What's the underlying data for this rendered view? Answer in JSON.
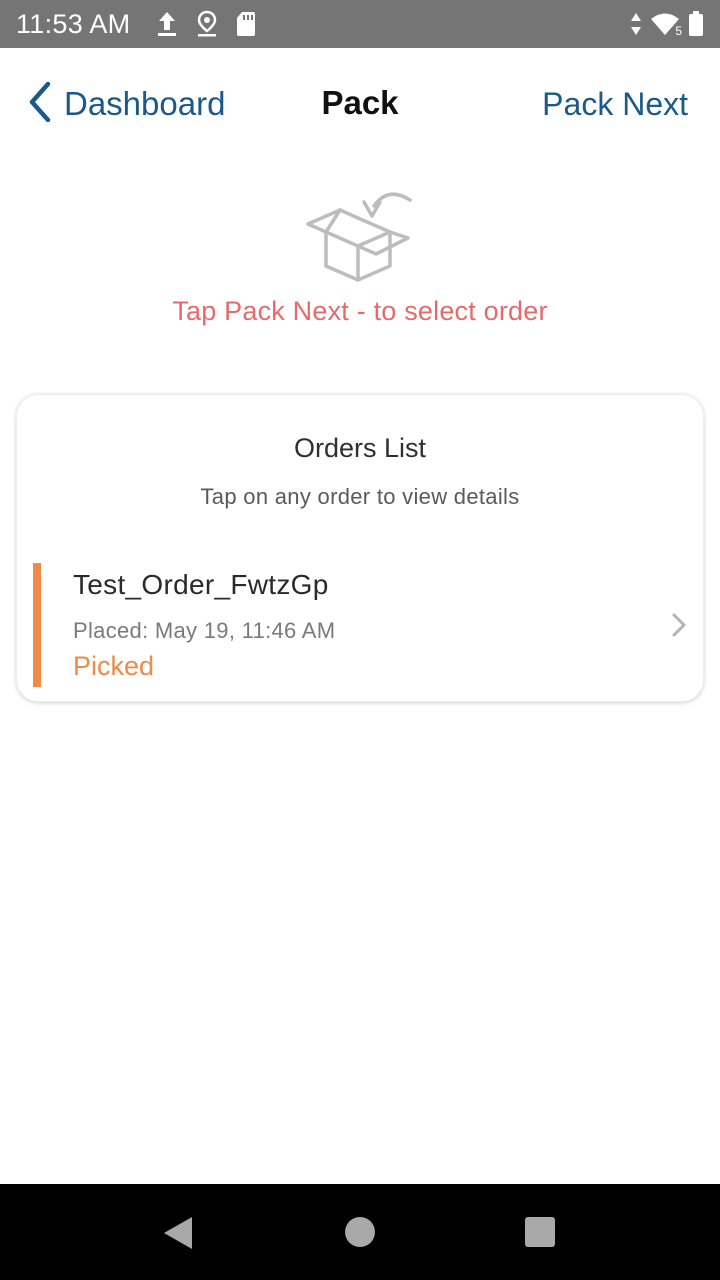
{
  "status_bar": {
    "time": "11:53 AM",
    "left_icons": [
      "upload-icon",
      "location-icon",
      "sd-card-icon"
    ],
    "right_icons": [
      "data-arrows-icon",
      "wifi-icon",
      "battery-icon"
    ],
    "wifi_badge": "5"
  },
  "header": {
    "back_label": "Dashboard",
    "title": "Pack",
    "action_label": "Pack Next"
  },
  "prompt": {
    "icon": "box-return-icon",
    "text": "Tap Pack Next - to select order"
  },
  "orders_card": {
    "title": "Orders List",
    "subtitle": "Tap on any order to view details",
    "orders": [
      {
        "name": "Test_Order_FwtzGp",
        "placed": "Placed: May 19, 11:46 AM",
        "status": "Picked"
      }
    ]
  },
  "colors": {
    "accent_blue": "#1a5a8a",
    "prompt_red": "#e8696a",
    "status_orange": "#ef8a47",
    "status_bar_gray": "#757575"
  },
  "android_nav": [
    "back-triangle-icon",
    "home-circle-icon",
    "recents-square-icon"
  ]
}
